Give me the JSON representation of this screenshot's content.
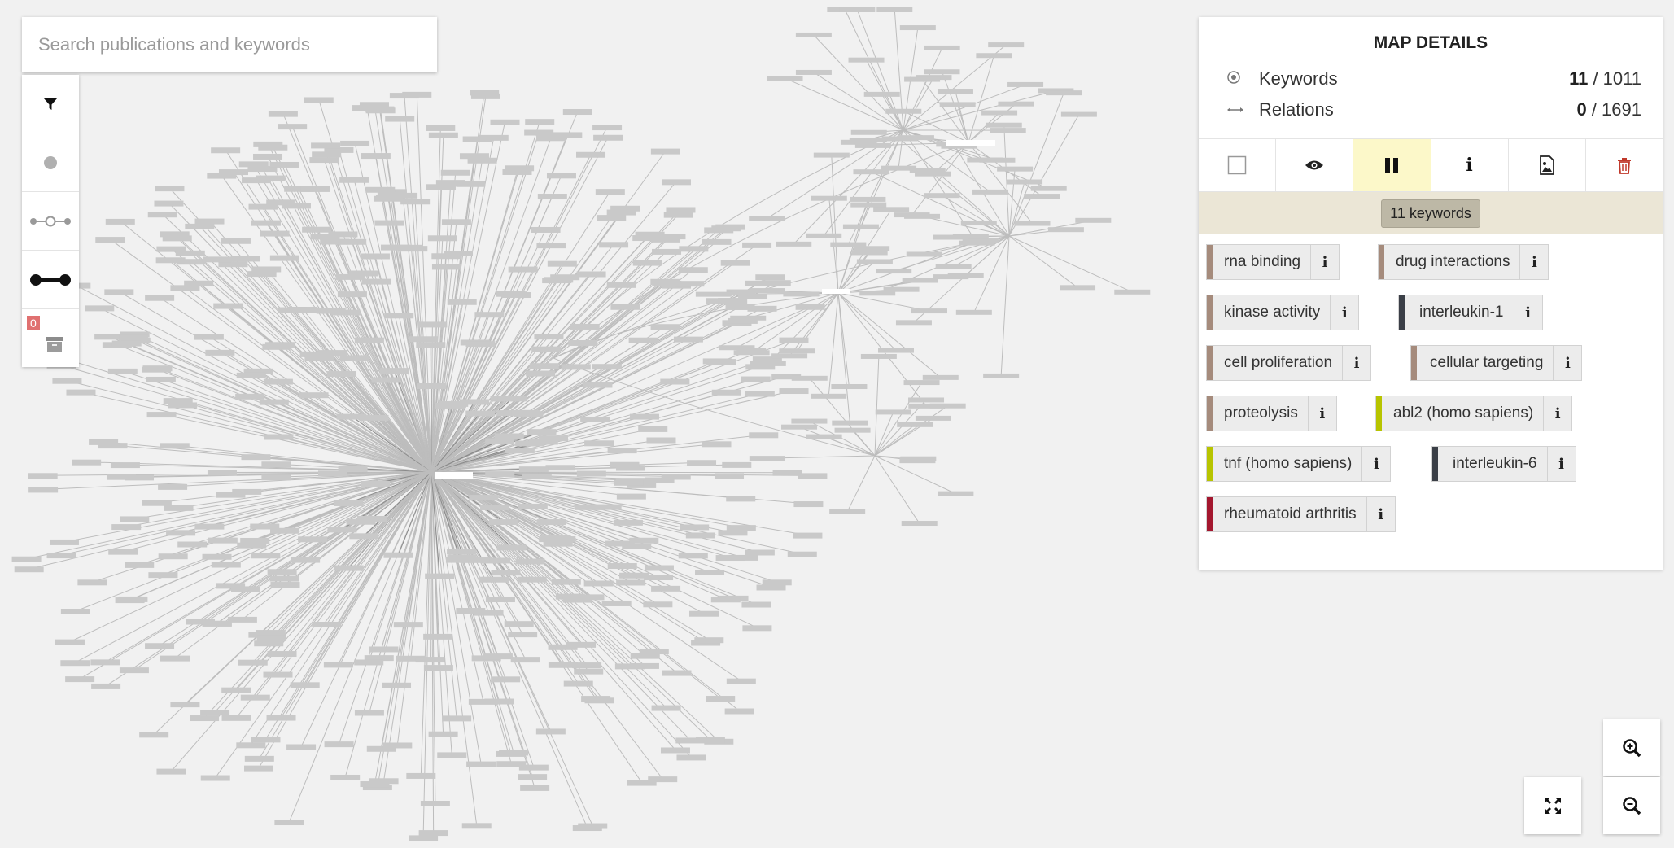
{
  "search": {
    "placeholder": "Search publications and keywords"
  },
  "toolbar": {
    "items": [
      "filter-icon",
      "node-icon",
      "relation-open-icon",
      "relation-filled-icon",
      "archive-icon"
    ],
    "archive_count": "0"
  },
  "panel": {
    "title": "MAP DETAILS",
    "keywords_label": "Keywords",
    "keywords_selected": "11",
    "keywords_total": " / 1011",
    "relations_label": "Relations",
    "relations_selected": "0",
    "relations_total": " / 1691",
    "actions": [
      "checkbox-icon",
      "eye-icon",
      "pause-icon",
      "info-icon",
      "image-icon",
      "trash-icon"
    ],
    "active_action": "pause-icon",
    "summary": "11 keywords",
    "info_glyph": "i",
    "keywords": [
      {
        "label": "rna binding",
        "color": "#a58b7c"
      },
      {
        "label": "drug interactions",
        "color": "#a58b7c"
      },
      {
        "label": "kinase activity",
        "color": "#a58b7c"
      },
      {
        "label": "interleukin-1",
        "color": "#3b3f47"
      },
      {
        "label": "cell proliferation",
        "color": "#a58b7c"
      },
      {
        "label": "cellular targeting",
        "color": "#a58b7c"
      },
      {
        "label": "proteolysis",
        "color": "#a58b7c"
      },
      {
        "label": "abl2 (homo sapiens)",
        "color": "#b7c400"
      },
      {
        "label": "tnf (homo sapiens)",
        "color": "#b7c400"
      },
      {
        "label": "interleukin-6",
        "color": "#3b3f47"
      },
      {
        "label": "rheumatoid arthritis",
        "color": "#a3162e"
      }
    ]
  },
  "controls": [
    "fullscreen-icon",
    "zoom-in-icon",
    "zoom-out-icon"
  ],
  "colors": {
    "delete": "#c0392b",
    "active_bg": "#fcf8c9",
    "summary_bg": "#ebe6d6"
  }
}
